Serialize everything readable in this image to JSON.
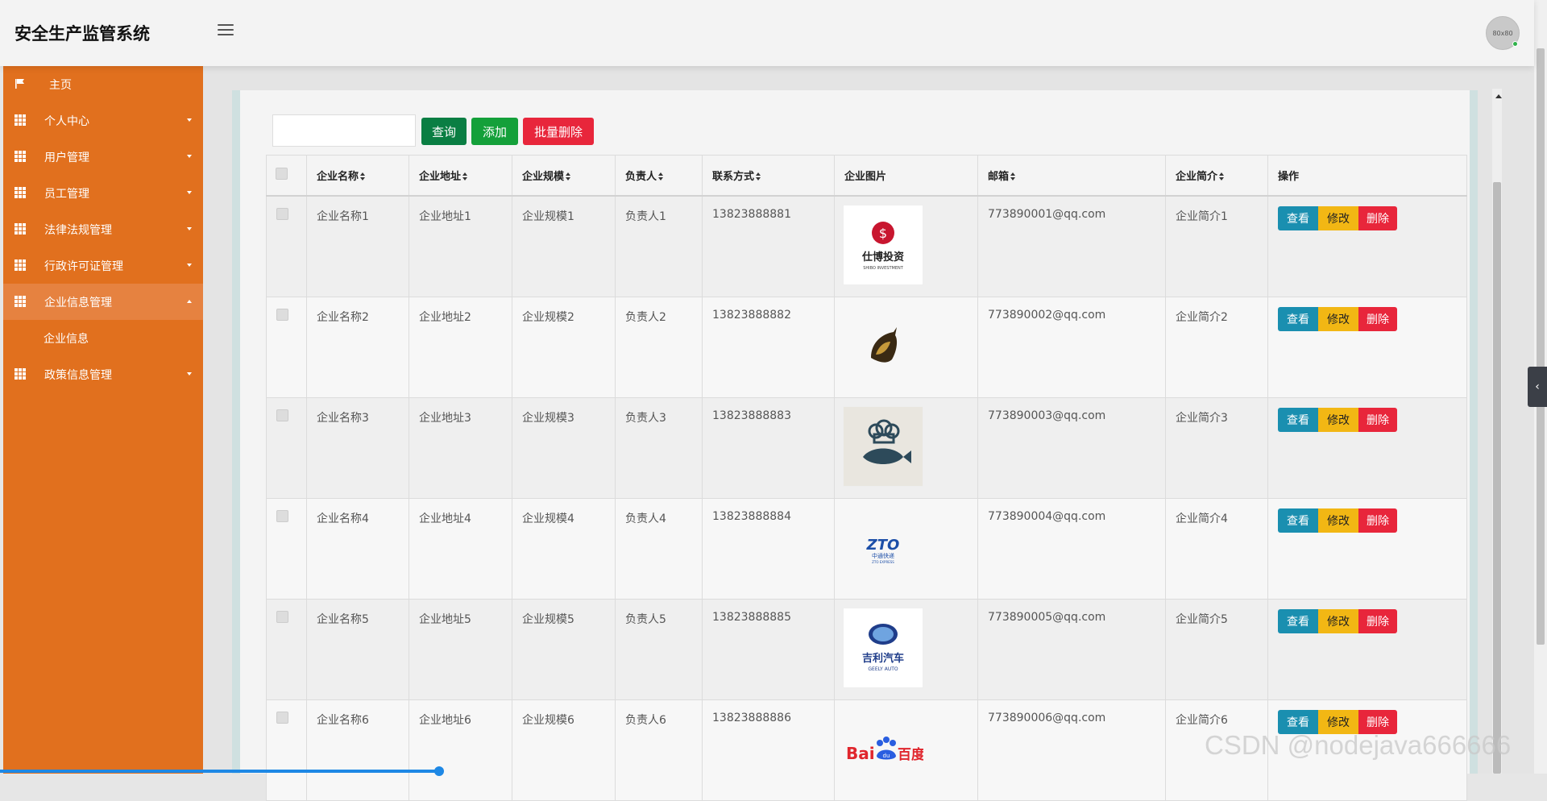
{
  "app": {
    "title": "安全生产监管系统",
    "avatar_text": "80x80"
  },
  "sidebar": {
    "items": [
      {
        "label": "主页",
        "icon": "flag-icon",
        "caret": ""
      },
      {
        "label": "个人中心",
        "icon": "grid-icon",
        "caret": "down"
      },
      {
        "label": "用户管理",
        "icon": "grid-icon",
        "caret": "down"
      },
      {
        "label": "员工管理",
        "icon": "grid-icon",
        "caret": "down"
      },
      {
        "label": "法律法规管理",
        "icon": "grid-icon",
        "caret": "down"
      },
      {
        "label": "行政许可证管理",
        "icon": "grid-icon",
        "caret": "down"
      },
      {
        "label": "企业信息管理",
        "icon": "grid-icon",
        "caret": "up",
        "active": true
      },
      {
        "label": "政策信息管理",
        "icon": "grid-icon",
        "caret": "down"
      }
    ],
    "submenu_label": "企业信息"
  },
  "toolbar": {
    "search_placeholder": "",
    "query_label": "查询",
    "add_label": "添加",
    "batch_delete_label": "批量删除"
  },
  "table": {
    "headers": [
      "企业名称",
      "企业地址",
      "企业规模",
      "负责人",
      "联系方式",
      "企业图片",
      "邮箱",
      "企业简介",
      "操作"
    ],
    "rows": [
      {
        "name": "企业名称1",
        "address": "企业地址1",
        "scale": "企业规模1",
        "owner": "负责人1",
        "phone": "13823888881",
        "image": "shibo-logo",
        "image_text": "仕博投资",
        "image_subtext": "SHIBO INVESTMENT",
        "email": "773890001@qq.com",
        "intro": "企业简介1"
      },
      {
        "name": "企业名称2",
        "address": "企业地址2",
        "scale": "企业规模2",
        "owner": "负责人2",
        "phone": "13823888882",
        "image": "horse-logo",
        "image_text": "",
        "image_subtext": "",
        "email": "773890002@qq.com",
        "intro": "企业简介2"
      },
      {
        "name": "企业名称3",
        "address": "企业地址3",
        "scale": "企业规模3",
        "owner": "负责人3",
        "phone": "13823888883",
        "image": "chef-fish-logo",
        "image_text": "",
        "image_subtext": "",
        "email": "773890003@qq.com",
        "intro": "企业简介3"
      },
      {
        "name": "企业名称4",
        "address": "企业地址4",
        "scale": "企业规模4",
        "owner": "负责人4",
        "phone": "13823888884",
        "image": "zto-logo",
        "image_text": "中通快递",
        "image_subtext": "ZTO EXPRESS",
        "email": "773890004@qq.com",
        "intro": "企业简介4"
      },
      {
        "name": "企业名称5",
        "address": "企业地址5",
        "scale": "企业规模5",
        "owner": "负责人5",
        "phone": "13823888885",
        "image": "geely-logo",
        "image_text": "吉利汽车",
        "image_subtext": "GEELY AUTO",
        "email": "773890005@qq.com",
        "intro": "企业简介5"
      },
      {
        "name": "企业名称6",
        "address": "企业地址6",
        "scale": "企业规模6",
        "owner": "负责人6",
        "phone": "13823888886",
        "image": "baidu-logo",
        "image_text": "百度",
        "image_subtext": "",
        "email": "773890006@qq.com",
        "intro": "企业简介6"
      }
    ],
    "actions": {
      "view": "查看",
      "edit": "修改",
      "delete": "删除"
    }
  },
  "watermark": "CSDN @nodejava666666",
  "colors": {
    "sidebar": "#e1701e",
    "query": "#0a7e43",
    "add": "#14a03a",
    "danger": "#e8263b",
    "view": "#1a8fb0",
    "edit": "#f2b714"
  }
}
